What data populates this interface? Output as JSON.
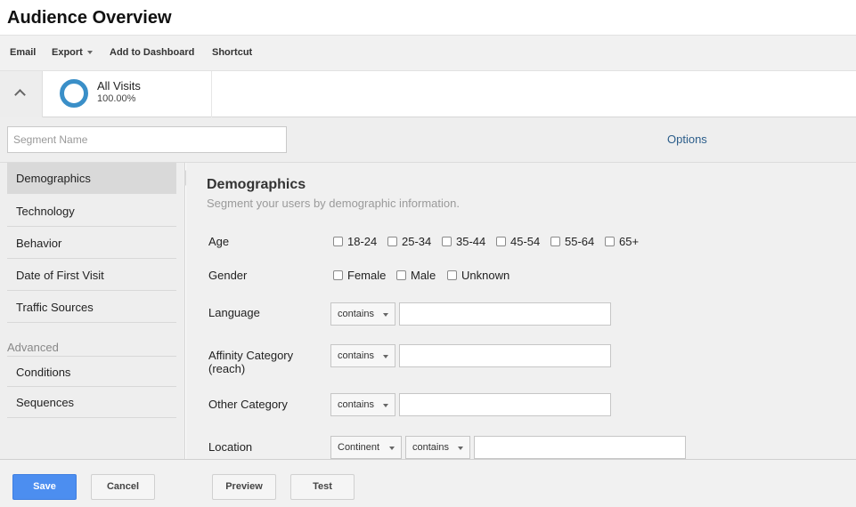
{
  "header": {
    "title": "Audience Overview"
  },
  "toolbar": {
    "email": "Email",
    "export": "Export",
    "add_to_dashboard": "Add to Dashboard",
    "shortcut": "Shortcut"
  },
  "segment": {
    "name": "All Visits",
    "percent": "100.00%",
    "ring_color": "#3a8fc8"
  },
  "editor": {
    "name_placeholder": "Segment Name",
    "options_label": "Options"
  },
  "sidebar": {
    "items": [
      "Demographics",
      "Technology",
      "Behavior",
      "Date of First Visit",
      "Traffic Sources"
    ],
    "active": "Demographics",
    "advanced_label": "Advanced",
    "advanced_items": [
      "Conditions",
      "Sequences"
    ]
  },
  "main": {
    "title": "Demographics",
    "subtitle": "Segment your users by demographic information.",
    "age": {
      "label": "Age",
      "options": [
        "18-24",
        "25-34",
        "35-44",
        "45-54",
        "55-64",
        "65+"
      ]
    },
    "gender": {
      "label": "Gender",
      "options": [
        "Female",
        "Male",
        "Unknown"
      ]
    },
    "language": {
      "label": "Language",
      "operator": "contains",
      "value": ""
    },
    "affinity": {
      "label": "Affinity Category (reach)",
      "operator": "contains",
      "value": ""
    },
    "other": {
      "label": "Other Category",
      "operator": "contains",
      "value": ""
    },
    "location": {
      "label": "Location",
      "scope": "Continent",
      "operator": "contains",
      "value": ""
    }
  },
  "footer": {
    "save": "Save",
    "cancel": "Cancel",
    "preview": "Preview",
    "test": "Test",
    "save_color": "#4c8ef0"
  }
}
